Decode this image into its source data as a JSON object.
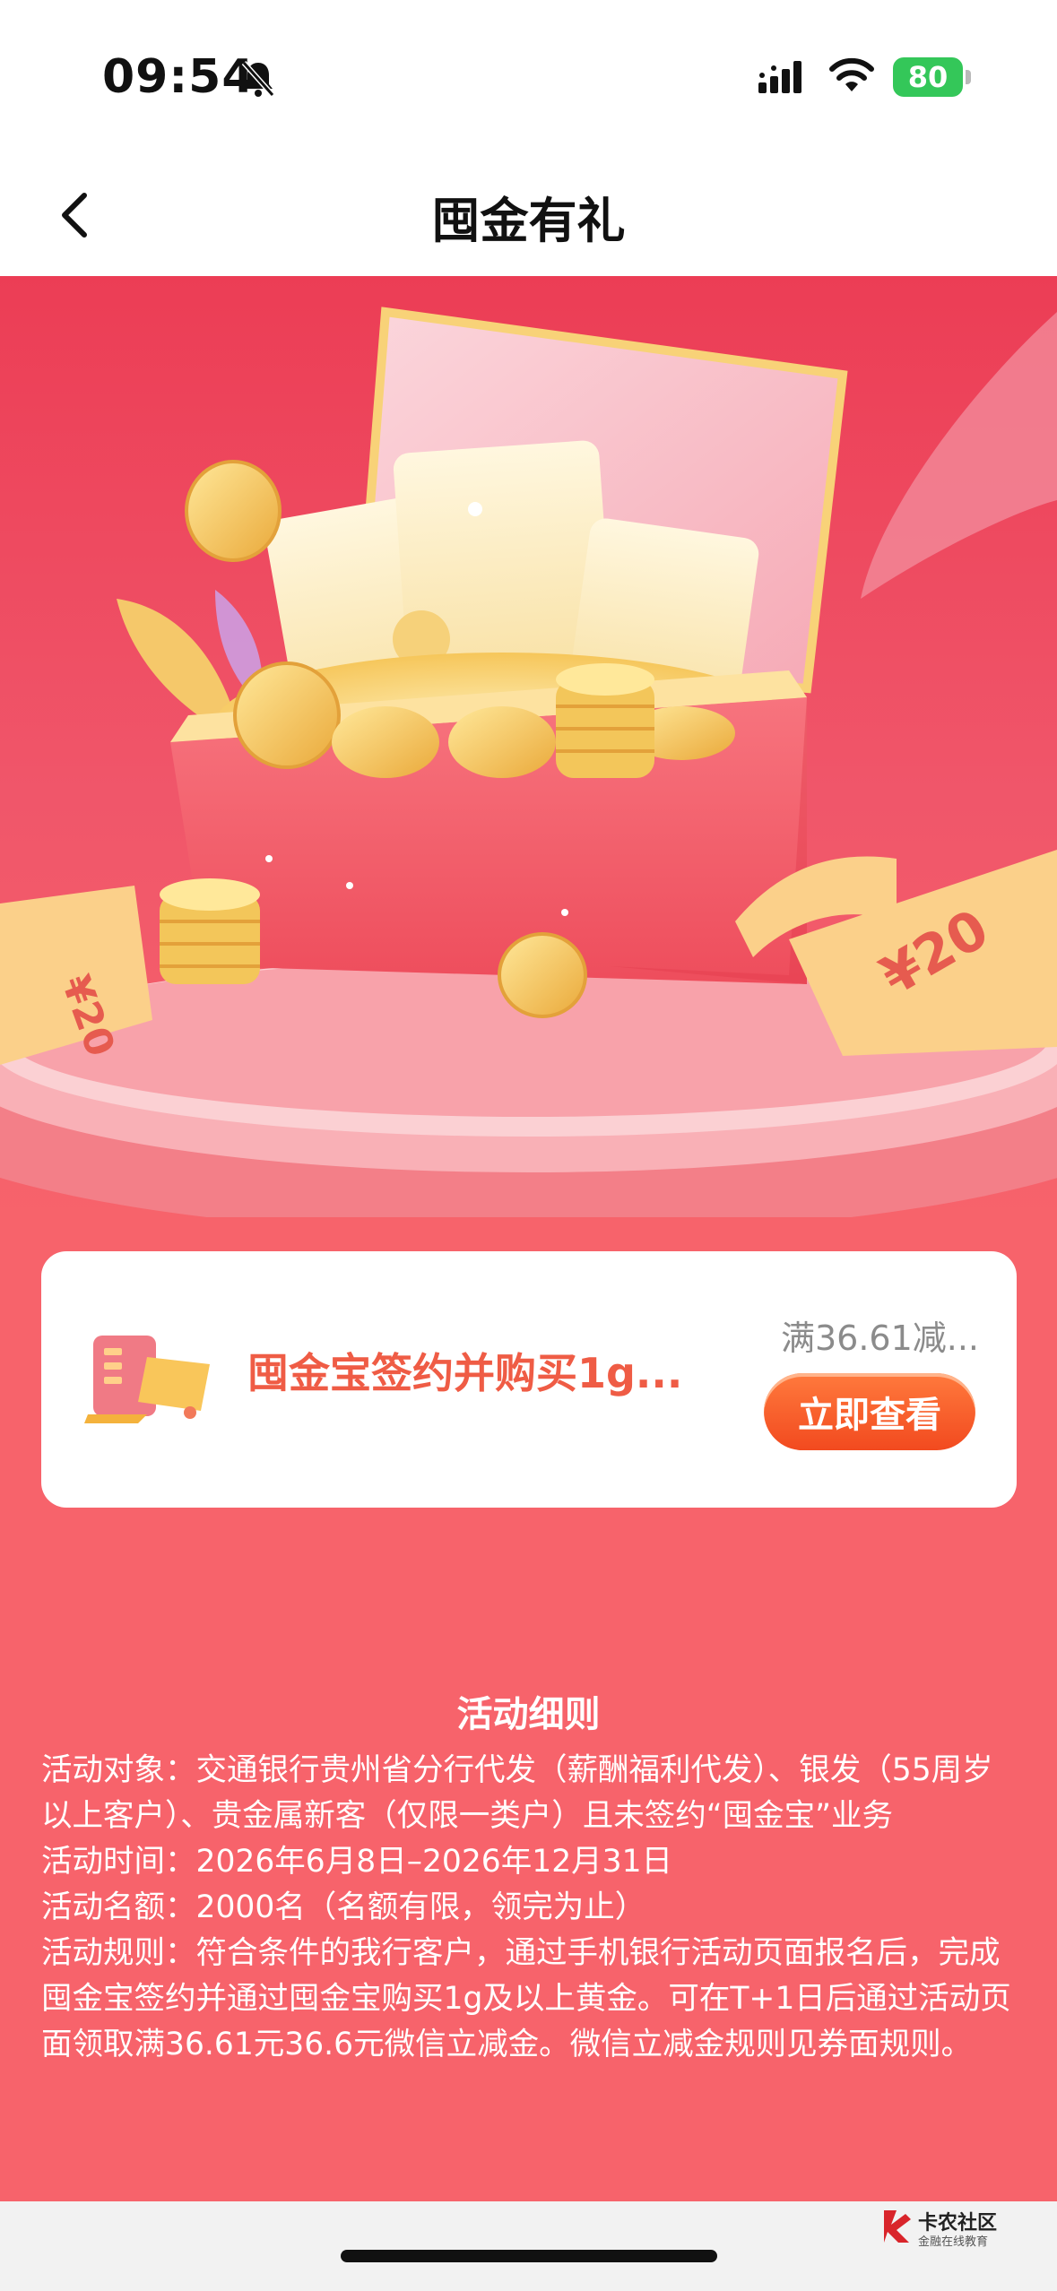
{
  "status_bar": {
    "time": "09:54",
    "battery": "80",
    "icons": [
      "bell-slash-icon",
      "signal-icon",
      "wifi-icon",
      "battery-icon"
    ]
  },
  "nav": {
    "title": "囤金有礼",
    "back_icon": "chevron-left-icon"
  },
  "hero": {
    "coupon_left": "¥20",
    "coupon_right": "¥20"
  },
  "card": {
    "title": "囤金宝签约并购买1g...",
    "subtitle": "满36.61减...",
    "button": "立即查看",
    "icon": "coupon-card-icon",
    "accent": "#ef5c45"
  },
  "rules": {
    "title": "活动细则",
    "lines": [
      "活动对象：交通银行贵州省分行代发（薪酬福利代发）、银发（55周岁以上客户）、贵金属新客（仅限一类户）且未签约“囤金宝”业务",
      "活动时间：2026年6月8日–2026年12月31日",
      "活动名额：2000名（名额有限，领完为止）",
      "活动规则：符合条件的我行客户，通过手机银行活动页面报名后，完成囤金宝签约并通过囤金宝购买1g及以上黄金。可在T+1日后通过活动页面领取满36.61元36.6元微信立减金。微信立减金规则见券面规则。"
    ]
  },
  "watermark": {
    "name": "卡农社区",
    "tagline": "金融在线教育"
  },
  "colors": {
    "background": "#f7636b",
    "button": "#f24a1f",
    "battery": "#34c759"
  }
}
